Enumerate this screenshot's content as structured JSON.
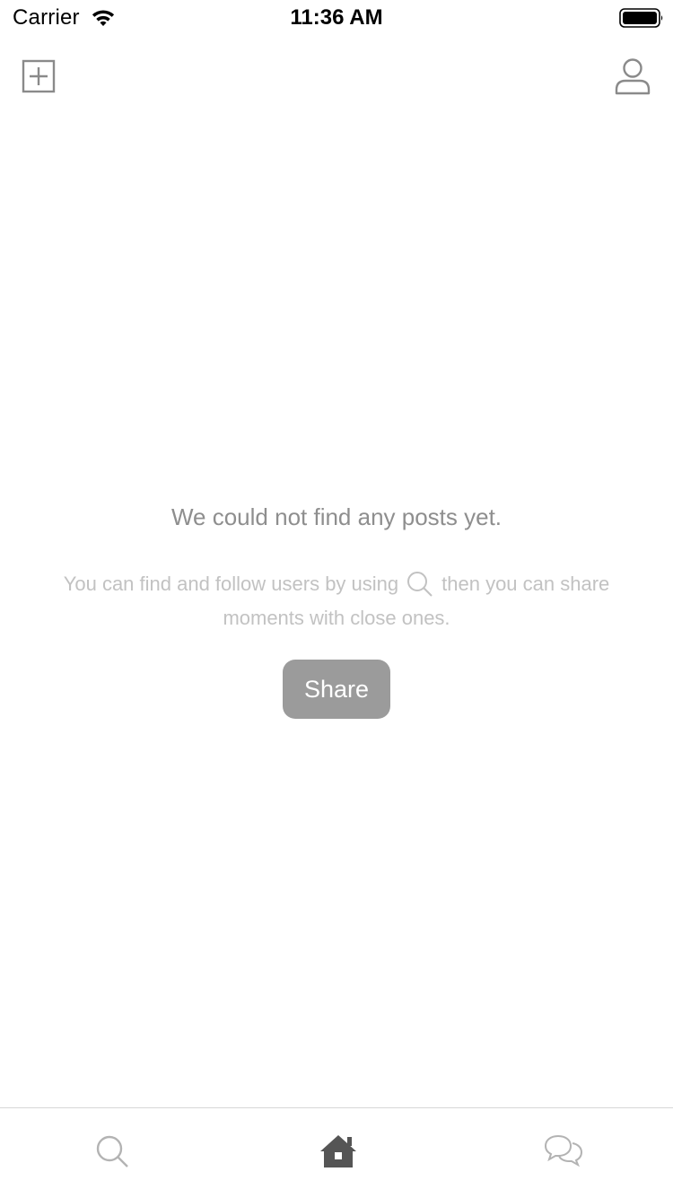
{
  "status_bar": {
    "carrier": "Carrier",
    "time": "11:36 AM",
    "icons": [
      "wifi-icon",
      "battery-icon"
    ]
  },
  "nav": {
    "left_icon": "plus-square-icon",
    "right_icon": "profile-icon"
  },
  "empty_state": {
    "title": "We could not find any posts yet.",
    "description_before": "You can find and follow users by using",
    "description_icon": "search-icon",
    "description_after": "then you can share moments with close ones.",
    "share_label": "Share"
  },
  "tab_bar": {
    "tabs": [
      {
        "icon": "search-icon",
        "selected": false
      },
      {
        "icon": "home-icon",
        "selected": true
      },
      {
        "icon": "chat-bubbles-icon",
        "selected": false
      }
    ]
  },
  "colors": {
    "title_text": "#8e8e8e",
    "description_text": "#c2c2c2",
    "button_bg": "#9b9b9b",
    "tab_selected": "#555555",
    "tab_unselected": "#b3b3b3"
  }
}
